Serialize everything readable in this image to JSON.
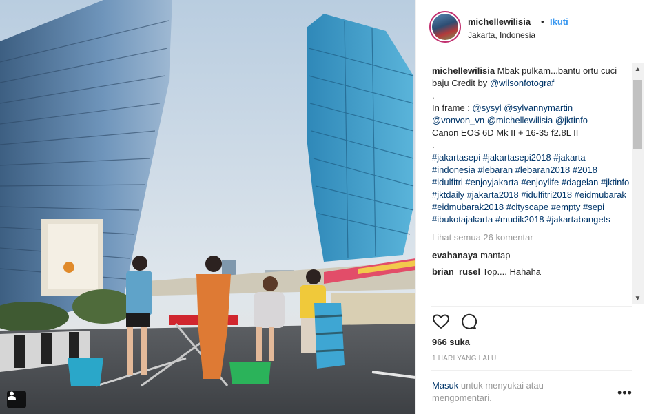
{
  "post": {
    "username": "michellewilisia",
    "dot": "•",
    "follow_label": "Ikuti",
    "location": "Jakarta, Indonesia"
  },
  "caption": {
    "username": "michellewilisia",
    "line1_text": "Mbak pulkam...bantu ortu cuci baju Credit by ",
    "line1_mention": "@wilsonfotograf",
    "dot1": ".",
    "inframe_label": "In frame : ",
    "mentions_1": "@sysyl @sylvannymartin",
    "mentions_2": "@vonvon_vn @michellewilisia @jktinfo",
    "camera": "Canon EOS 6D Mk II + 16-35 f2.8L II",
    "dot2": ".",
    "hashtags": "#jakartasepi #jakartasepi2018 #jakarta #indonesia #lebaran #lebaran2018 #2018 #idulfitri #enjoyjakarta #enjoylife #dagelan #jktinfo #jktdaily #jakarta2018 #idulfitri2018 #eidmubarak #eidmubarak2018 #cityscape #empty #sepi #ibukotajakarta #mudik2018 #jakartabangets"
  },
  "view_all_comments": "Lihat semua 26 komentar",
  "comments": [
    {
      "user": "evahanaya",
      "text": "mantap"
    },
    {
      "user": "brian_rusel",
      "text": "Top.... Hahaha"
    }
  ],
  "likes": "966 suka",
  "time_ago": "1 HARI YANG LALU",
  "login": {
    "link": "Masuk",
    "text": " untuk menyukai atau mengomentari."
  },
  "more_options": "•••",
  "icons": {
    "like": "heart-icon",
    "comment": "comment-icon",
    "tag": "user-tag-icon"
  },
  "colors": {
    "link": "#003569",
    "follow": "#3897f0",
    "muted": "#999999"
  }
}
